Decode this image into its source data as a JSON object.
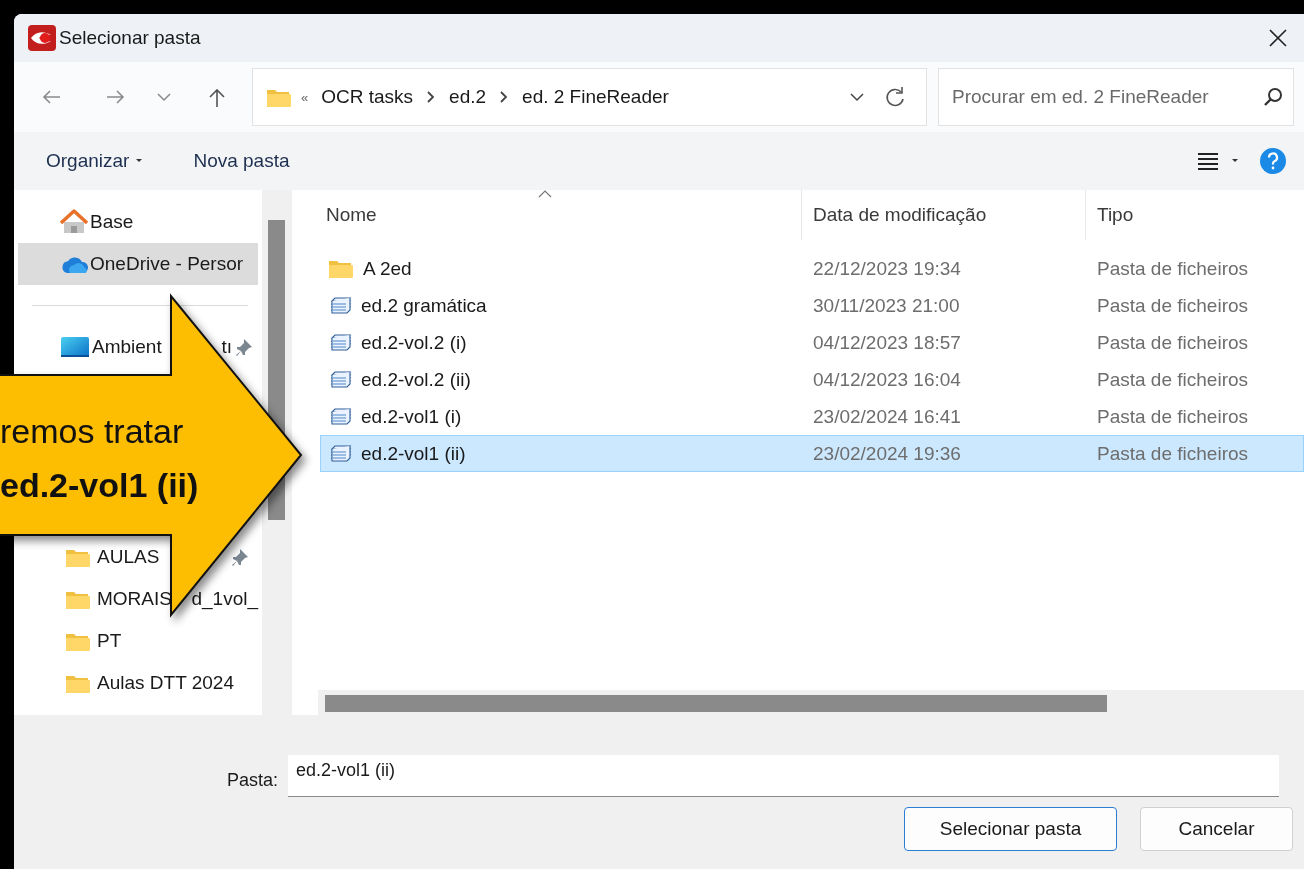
{
  "window": {
    "title": "Selecionar pasta"
  },
  "address": {
    "overflow": "«",
    "breadcrumbs": [
      "OCR tasks",
      "ed.2",
      "ed. 2 FineReader"
    ]
  },
  "search": {
    "placeholder": "Procurar em ed. 2 FineReader"
  },
  "toolbar": {
    "organize": "Organizar",
    "new_folder": "Nova pasta"
  },
  "sidebar": {
    "top": [
      {
        "label": "Base",
        "kind": "home",
        "selected": false
      },
      {
        "label": "OneDrive - Persor",
        "kind": "cloud",
        "selected": true
      }
    ],
    "quick": [
      {
        "label": "Ambient",
        "label_tail": "tı",
        "kind": "desktop",
        "pinned": true,
        "selected": false
      }
    ],
    "folders": [
      {
        "label": "AULAS",
        "kind": "folder",
        "pinned": true,
        "selected": false
      },
      {
        "label": "MORAIS",
        "label_tail": "d_1vol_",
        "kind": "folder",
        "pinned": false,
        "selected": false
      },
      {
        "label": "PT",
        "kind": "folder",
        "pinned": false,
        "selected": false
      },
      {
        "label": "Aulas DTT 2024",
        "kind": "folder",
        "pinned": false,
        "selected": false
      }
    ]
  },
  "table": {
    "columns": [
      {
        "label": "Nome",
        "sorted": true
      },
      {
        "label": "Data de modificação",
        "sorted": false
      },
      {
        "label": "Tipo",
        "sorted": false
      }
    ],
    "rows": [
      {
        "name": "A 2ed",
        "date": "22/12/2023 19:34",
        "type": "Pasta de ficheiros",
        "kind": "folder",
        "selected": false
      },
      {
        "name": "ed.2 gramática",
        "date": "30/11/2023 21:00",
        "type": "Pasta de ficheiros",
        "kind": "stack",
        "selected": false
      },
      {
        "name": "ed.2-vol.2 (i)",
        "date": "04/12/2023 18:57",
        "type": "Pasta de ficheiros",
        "kind": "stack",
        "selected": false
      },
      {
        "name": "ed.2-vol.2 (ii)",
        "date": "04/12/2023 16:04",
        "type": "Pasta de ficheiros",
        "kind": "stack",
        "selected": false
      },
      {
        "name": "ed.2-vol1 (i)",
        "date": "23/02/2024 16:41",
        "type": "Pasta de ficheiros",
        "kind": "stack",
        "selected": false
      },
      {
        "name": "ed.2-vol1 (ii)",
        "date": "23/02/2024 19:36",
        "type": "Pasta de ficheiros",
        "kind": "stack",
        "selected": true
      }
    ]
  },
  "footer": {
    "label": "Pasta:",
    "value": "ed.2-vol1 (ii)",
    "buttons": [
      {
        "label": "Selecionar pasta",
        "default": true
      },
      {
        "label": "Cancelar",
        "default": false
      }
    ]
  },
  "callout": {
    "line_1": "remos tratar",
    "line_2": "ed.2-vol1 (ii)"
  }
}
